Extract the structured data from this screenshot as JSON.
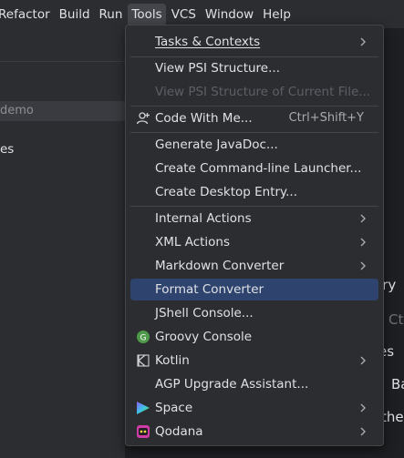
{
  "menubar": {
    "items": [
      {
        "label": "Refactor"
      },
      {
        "label": "Build"
      },
      {
        "label": "Run"
      },
      {
        "label": "Tools"
      },
      {
        "label": "VCS"
      },
      {
        "label": "Window"
      },
      {
        "label": "Help"
      }
    ]
  },
  "left_panel": {
    "search_text": "demo",
    "partial_text": "es"
  },
  "background_fragments": [
    "ery",
    "Ct",
    "es",
    "Ba",
    "the"
  ],
  "tools_menu": {
    "items": [
      {
        "label": "Tasks & Contexts",
        "submenu": true
      },
      {
        "label": "View PSI Structure..."
      },
      {
        "label": "View PSI Structure of Current File...",
        "disabled": true
      },
      {
        "label": "Code With Me...",
        "shortcut": "Ctrl+Shift+Y",
        "icon": "code-with-me-icon"
      },
      {
        "label": "Generate JavaDoc..."
      },
      {
        "label": "Create Command-line Launcher..."
      },
      {
        "label": "Create Desktop Entry..."
      },
      {
        "label": "Internal Actions",
        "submenu": true
      },
      {
        "label": "XML Actions",
        "submenu": true
      },
      {
        "label": "Markdown Converter",
        "submenu": true
      },
      {
        "label": "Format Converter",
        "selected": true
      },
      {
        "label": "JShell Console..."
      },
      {
        "label": "Groovy Console",
        "icon": "groovy-icon"
      },
      {
        "label": "Kotlin",
        "submenu": true,
        "icon": "kotlin-icon"
      },
      {
        "label": "AGP Upgrade Assistant..."
      },
      {
        "label": "Space",
        "submenu": true,
        "icon": "space-icon"
      },
      {
        "label": "Qodana",
        "submenu": true,
        "icon": "qodana-icon"
      }
    ]
  },
  "colors": {
    "selection": "#2e436e",
    "menu_bg": "#2b2d30",
    "groovy_green": "#4e9a4a"
  }
}
